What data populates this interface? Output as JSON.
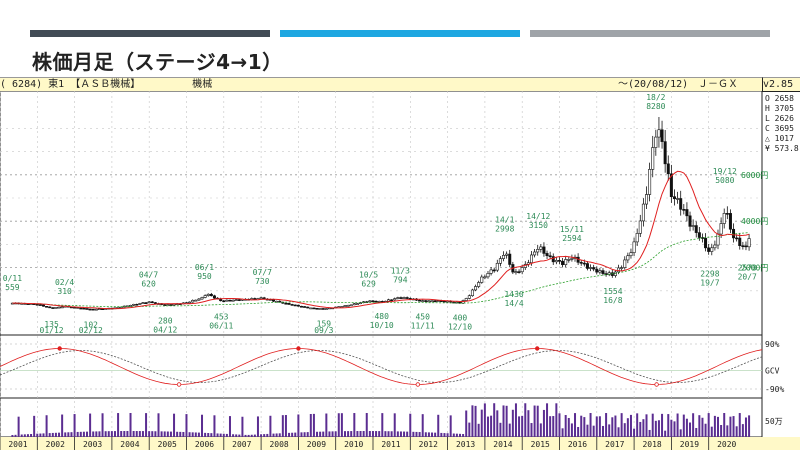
{
  "page": {
    "title": "株価月足（ステージ4→1）"
  },
  "header": {
    "stock": "( 6284) 東1 【ＡＳＢ機械】",
    "sector": "機械",
    "period": "〜(20/08/12)",
    "source": "Ｊ－ＧＸ",
    "version": "v2.85"
  },
  "colors": {
    "bar_dark": "#414b55",
    "bar_blue": "#1ea7e1",
    "bar_gray": "#9fa3a8",
    "candle": "#111111",
    "ma_short": "#e02020",
    "ma_long": "#2ca02c",
    "annotation": "#2e8b57",
    "volume": "#5b2d91",
    "osc_gray": "#555555"
  },
  "chart_data": {
    "type": "candlestick",
    "title": "株価月足（ステージ4→1）",
    "x_ticks": [
      "2001",
      "2002",
      "2003",
      "2004",
      "2005",
      "2006",
      "2007",
      "2008",
      "2009",
      "2010",
      "2011",
      "2012",
      "2013",
      "2014",
      "2015",
      "2016",
      "2017",
      "2018",
      "2019",
      "2020"
    ],
    "y_ticks": [
      "6000円",
      "4000円",
      "2000円"
    ],
    "y_ticks_values": [
      6000,
      4000,
      2000
    ],
    "stats": [
      "O 2658",
      "H 3705",
      "L 2626",
      "C 3695",
      "△ 1017",
      "¥ 573.8"
    ],
    "osc_labels": [
      "90%",
      "GCV",
      "-90%"
    ],
    "volume_label": "50万",
    "annotations": [
      {
        "text": "0/11",
        "x": 2000.85,
        "y": 470,
        "pos": "above"
      },
      {
        "text": "559",
        "x": 2000.85,
        "y": 470,
        "pos": "above2"
      },
      {
        "text": "02/4",
        "x": 2002.25,
        "y": 310,
        "pos": "above"
      },
      {
        "text": "310",
        "x": 2002.25,
        "y": 310,
        "pos": "above2"
      },
      {
        "text": "135",
        "x": 2001.9,
        "y": 135,
        "pos": "below"
      },
      {
        "text": "01/12",
        "x": 2001.9,
        "y": 135,
        "pos": "below2"
      },
      {
        "text": "102",
        "x": 2002.95,
        "y": 102,
        "pos": "below"
      },
      {
        "text": "02/12",
        "x": 2002.95,
        "y": 102,
        "pos": "below2"
      },
      {
        "text": "04/7",
        "x": 2004.5,
        "y": 620,
        "pos": "above"
      },
      {
        "text": "620",
        "x": 2004.5,
        "y": 620,
        "pos": "above2"
      },
      {
        "text": "280",
        "x": 2004.95,
        "y": 280,
        "pos": "below"
      },
      {
        "text": "04/12",
        "x": 2004.95,
        "y": 280,
        "pos": "below2"
      },
      {
        "text": "06/1",
        "x": 2006.0,
        "y": 950,
        "pos": "above"
      },
      {
        "text": "950",
        "x": 2006.0,
        "y": 950,
        "pos": "above2"
      },
      {
        "text": "453",
        "x": 2006.45,
        "y": 453,
        "pos": "below"
      },
      {
        "text": "06/11",
        "x": 2006.45,
        "y": 453,
        "pos": "below2"
      },
      {
        "text": "07/7",
        "x": 2007.55,
        "y": 730,
        "pos": "above"
      },
      {
        "text": "730",
        "x": 2007.55,
        "y": 730,
        "pos": "above2"
      },
      {
        "text": "159",
        "x": 2009.2,
        "y": 159,
        "pos": "below"
      },
      {
        "text": "09/3",
        "x": 2009.2,
        "y": 159,
        "pos": "below2"
      },
      {
        "text": "10/5",
        "x": 2010.4,
        "y": 629,
        "pos": "above"
      },
      {
        "text": "629",
        "x": 2010.4,
        "y": 629,
        "pos": "above2"
      },
      {
        "text": "480",
        "x": 2010.75,
        "y": 480,
        "pos": "below"
      },
      {
        "text": "10/10",
        "x": 2010.75,
        "y": 480,
        "pos": "below2"
      },
      {
        "text": "11/3",
        "x": 2011.25,
        "y": 794,
        "pos": "above"
      },
      {
        "text": "794",
        "x": 2011.25,
        "y": 794,
        "pos": "above2"
      },
      {
        "text": "450",
        "x": 2011.85,
        "y": 450,
        "pos": "below"
      },
      {
        "text": "11/11",
        "x": 2011.85,
        "y": 450,
        "pos": "below2"
      },
      {
        "text": "400",
        "x": 2012.85,
        "y": 400,
        "pos": "below"
      },
      {
        "text": "12/10",
        "x": 2012.85,
        "y": 400,
        "pos": "below2"
      },
      {
        "text": "14/1",
        "x": 2014.05,
        "y": 2998,
        "pos": "above"
      },
      {
        "text": "2998",
        "x": 2014.05,
        "y": 2998,
        "pos": "above2"
      },
      {
        "text": "1430",
        "x": 2014.3,
        "y": 1430,
        "pos": "below"
      },
      {
        "text": "14/4",
        "x": 2014.3,
        "y": 1430,
        "pos": "below2"
      },
      {
        "text": "14/12",
        "x": 2014.95,
        "y": 3150,
        "pos": "above"
      },
      {
        "text": "3150",
        "x": 2014.95,
        "y": 3150,
        "pos": "above2"
      },
      {
        "text": "15/11",
        "x": 2015.85,
        "y": 2594,
        "pos": "above"
      },
      {
        "text": "2594",
        "x": 2015.85,
        "y": 2594,
        "pos": "above2"
      },
      {
        "text": "1554",
        "x": 2016.95,
        "y": 1554,
        "pos": "below"
      },
      {
        "text": "16/8",
        "x": 2016.95,
        "y": 1554,
        "pos": "below2"
      },
      {
        "text": "18/2",
        "x": 2018.1,
        "y": 8280,
        "pos": "above"
      },
      {
        "text": "8280",
        "x": 2018.1,
        "y": 8280,
        "pos": "above2"
      },
      {
        "text": "19/12",
        "x": 2019.95,
        "y": 5080,
        "pos": "above"
      },
      {
        "text": "5080",
        "x": 2019.95,
        "y": 5080,
        "pos": "above2"
      },
      {
        "text": "2298",
        "x": 2019.55,
        "y": 2298,
        "pos": "below"
      },
      {
        "text": "19/7",
        "x": 2019.55,
        "y": 2298,
        "pos": "below2"
      },
      {
        "text": "2570",
        "x": 2020.55,
        "y": 2570,
        "pos": "below"
      },
      {
        "text": "20/7",
        "x": 2020.55,
        "y": 2570,
        "pos": "below2"
      }
    ],
    "price_anchors": [
      [
        2000.85,
        470
      ],
      [
        2001.5,
        420
      ],
      [
        2001.9,
        250
      ],
      [
        2002.25,
        330
      ],
      [
        2002.95,
        200
      ],
      [
        2003.6,
        260
      ],
      [
        2004.5,
        520
      ],
      [
        2004.95,
        380
      ],
      [
        2005.5,
        480
      ],
      [
        2005.95,
        700
      ],
      [
        2006.05,
        880
      ],
      [
        2006.45,
        560
      ],
      [
        2007.0,
        620
      ],
      [
        2007.55,
        680
      ],
      [
        2008.2,
        440
      ],
      [
        2008.8,
        260
      ],
      [
        2009.2,
        220
      ],
      [
        2009.8,
        360
      ],
      [
        2010.4,
        560
      ],
      [
        2010.75,
        520
      ],
      [
        2011.25,
        720
      ],
      [
        2011.85,
        560
      ],
      [
        2012.4,
        560
      ],
      [
        2012.85,
        480
      ],
      [
        2013.05,
        700
      ],
      [
        2013.4,
        1500
      ],
      [
        2013.8,
        2000
      ],
      [
        2014.05,
        2700
      ],
      [
        2014.3,
        1700
      ],
      [
        2014.6,
        2100
      ],
      [
        2014.95,
        2900
      ],
      [
        2015.3,
        2350
      ],
      [
        2015.6,
        2200
      ],
      [
        2015.85,
        2450
      ],
      [
        2016.3,
        2000
      ],
      [
        2016.7,
        1750
      ],
      [
        2016.95,
        1700
      ],
      [
        2017.2,
        2100
      ],
      [
        2017.5,
        2900
      ],
      [
        2017.8,
        4800
      ],
      [
        2018.1,
        7900
      ],
      [
        2018.25,
        7600
      ],
      [
        2018.5,
        5200
      ],
      [
        2018.8,
        4600
      ],
      [
        2019.05,
        3800
      ],
      [
        2019.3,
        3300
      ],
      [
        2019.55,
        2600
      ],
      [
        2019.8,
        3500
      ],
      [
        2019.95,
        4600
      ],
      [
        2020.15,
        3400
      ],
      [
        2020.3,
        3100
      ],
      [
        2020.45,
        2900
      ],
      [
        2020.55,
        2800
      ],
      [
        2020.62,
        3600
      ]
    ]
  }
}
